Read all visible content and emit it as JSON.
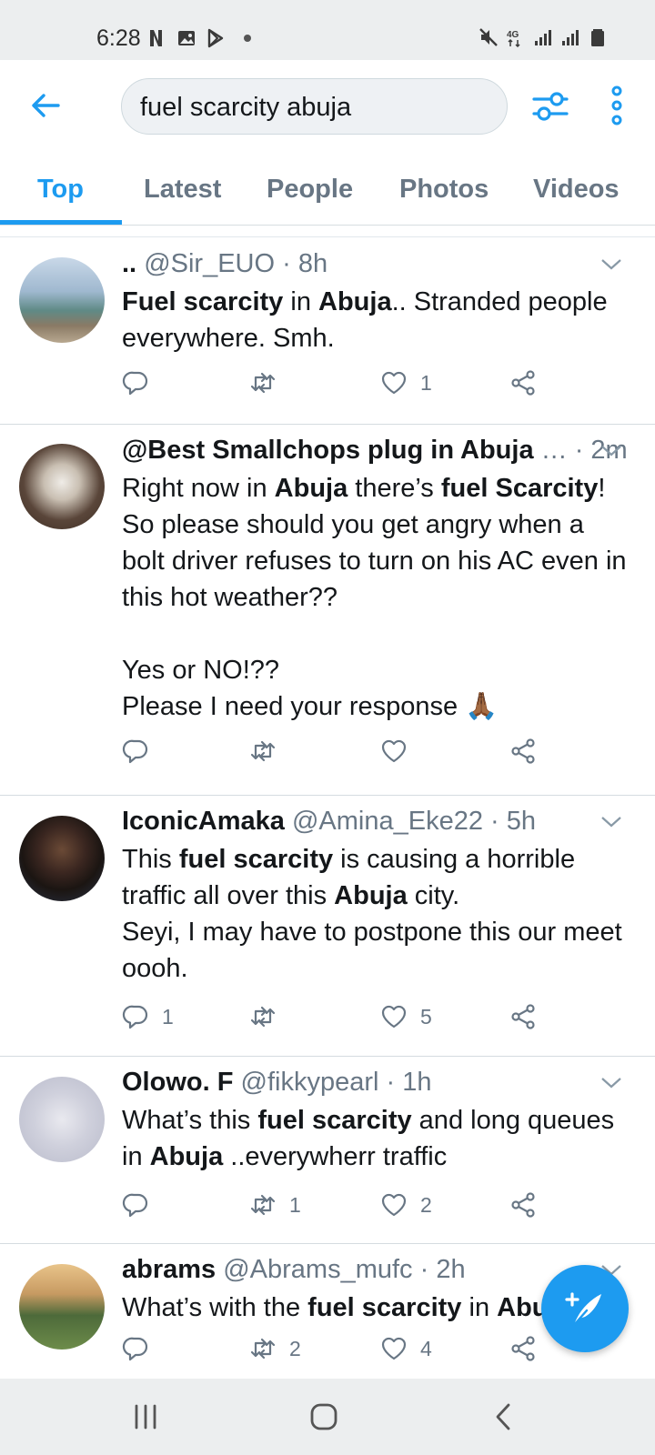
{
  "status_bar": {
    "time": "6:28",
    "left_icons": [
      "netflix-icon",
      "gallery-icon",
      "play-store-icon"
    ],
    "right_icons": [
      "mute-icon",
      "4g-icon",
      "signal-icon",
      "signal-icon",
      "battery-icon"
    ],
    "network": "4G"
  },
  "search": {
    "query": "fuel scarcity abuja"
  },
  "tabs": [
    {
      "label": "Top",
      "active": true
    },
    {
      "label": "Latest",
      "active": false
    },
    {
      "label": "People",
      "active": false
    },
    {
      "label": "Photos",
      "active": false
    },
    {
      "label": "Videos",
      "active": false
    }
  ],
  "tweets": [
    {
      "name": "..",
      "handle": "@Sir_EUO",
      "time": "· 8h",
      "reply_count": "",
      "retweet_count": "",
      "like_count": "1",
      "body_segments": [
        {
          "t": "Fuel scarcity",
          "b": true
        },
        {
          "t": " in ",
          "b": false
        },
        {
          "t": "Abuja",
          "b": true
        },
        {
          "t": ".. Stranded people everywhere. Smh.",
          "b": false
        }
      ]
    },
    {
      "name": "@Best Smallchops plug in Abuja",
      "handle": "…",
      "time": "· 2m",
      "reply_count": "",
      "retweet_count": "",
      "like_count": "",
      "body_segments": [
        {
          "t": "Right now in ",
          "b": false
        },
        {
          "t": "Abuja",
          "b": true
        },
        {
          "t": " there’s ",
          "b": false
        },
        {
          "t": "fuel Scarcity",
          "b": true
        },
        {
          "t": "!\nSo please should you get angry when a bolt driver refuses to turn on his AC even in this hot weather??\n\nYes or NO!??\nPlease I need your response 🙏🏾",
          "b": false
        }
      ]
    },
    {
      "name": "IconicAmaka",
      "handle": "@Amina_Eke22",
      "time": "· 5h",
      "reply_count": "1",
      "retweet_count": "",
      "like_count": "5",
      "body_segments": [
        {
          "t": "This ",
          "b": false
        },
        {
          "t": "fuel scarcity",
          "b": true
        },
        {
          "t": " is causing a horrible traffic all over this ",
          "b": false
        },
        {
          "t": "Abuja",
          "b": true
        },
        {
          "t": " city.\nSeyi, I may have to postpone this our meet oooh.",
          "b": false
        }
      ]
    },
    {
      "name": "Olowo. F",
      "handle": "@fikkypearl",
      "time": "· 1h",
      "reply_count": "",
      "retweet_count": "1",
      "like_count": "2",
      "body_segments": [
        {
          "t": "What’s this ",
          "b": false
        },
        {
          "t": "fuel scarcity",
          "b": true
        },
        {
          "t": " and long queues in ",
          "b": false
        },
        {
          "t": "Abuja",
          "b": true
        },
        {
          "t": " ..everywherr traffic",
          "b": false
        }
      ]
    },
    {
      "name": "abrams",
      "handle": "@Abrams_mufc",
      "time": "· 2h",
      "reply_count": "",
      "retweet_count": "2",
      "like_count": "4",
      "body_segments": [
        {
          "t": "What’s with the ",
          "b": false
        },
        {
          "t": "fuel scarcity",
          "b": true
        },
        {
          "t": " in ",
          "b": false
        },
        {
          "t": "Abu",
          "b": true
        }
      ]
    }
  ],
  "colors": {
    "accent": "#1d9bf0",
    "muted": "#687684",
    "text": "#14171a",
    "bar_bg": "#eceeef"
  },
  "fab": {
    "icon": "compose-tweet-icon"
  },
  "nav_bar": {
    "buttons": [
      "recents-icon",
      "home-icon",
      "back-icon"
    ]
  }
}
